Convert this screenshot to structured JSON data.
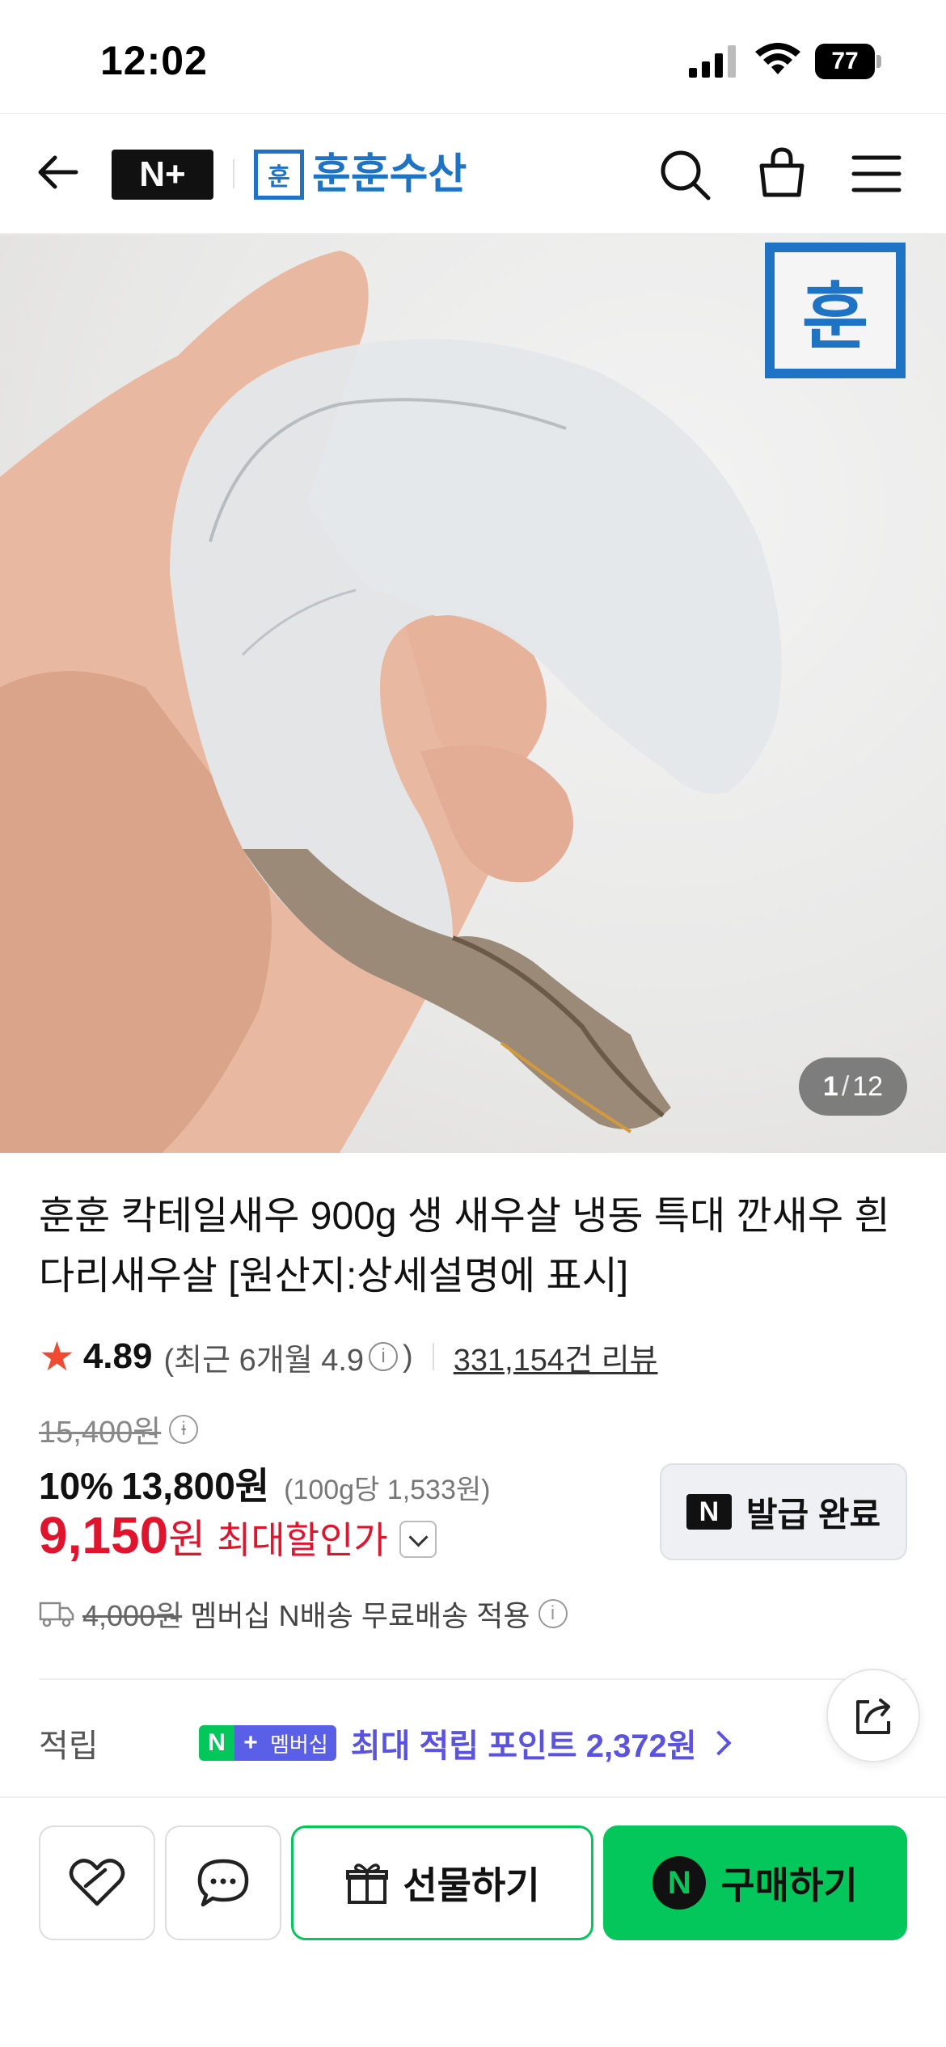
{
  "status_bar": {
    "time": "12:02",
    "battery": "77"
  },
  "header": {
    "nplus_label": "N+",
    "brand_logo_char": "훈",
    "brand_name": "훈훈수산"
  },
  "gallery": {
    "stamp_char": "훈",
    "current": "1",
    "separator": "/",
    "total": "12"
  },
  "product": {
    "title": "훈훈 칵테일새우 900g 생 새우살 냉동 특대 깐새우 흰다리새우살 [원산지:상세설명에 표시]",
    "rating": "4.89",
    "recent_rating_prefix": "(최근 6개월 4.9",
    "recent_rating_suffix": ")",
    "review_count": "331,154건 리뷰",
    "original_price": "15,400원",
    "discount_percent": "10%",
    "discounted_price": "13,800원",
    "unit_price": "(100g당 1,533원)",
    "max_sale_price": "9,150",
    "max_sale_won": "원",
    "max_sale_label": "최대할인가",
    "coupon_badge": "N",
    "coupon_button": "발급 완료",
    "shipping_original": "4,000원",
    "shipping_text": "멤버십 N배송 무료배송 적용"
  },
  "points": {
    "label": "적립",
    "badge_n": "N",
    "badge_plus": "+",
    "badge_membership": "멤버십",
    "text": "최대 적립 포인트 2,372원"
  },
  "bottom_bar": {
    "gift_label": "선물하기",
    "buy_badge": "N",
    "buy_label": "구매하기"
  },
  "colors": {
    "brand_blue": "#1e73c4",
    "naver_green": "#03c75a",
    "sale_red": "#e0142c",
    "points_purple": "#5a52e0"
  }
}
